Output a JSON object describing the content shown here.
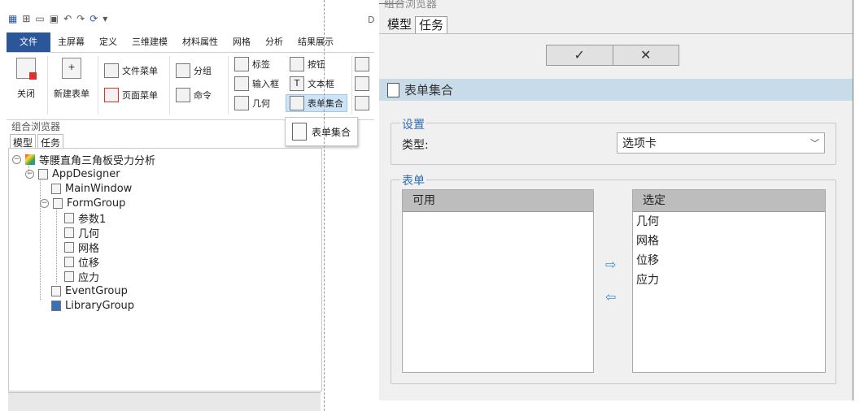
{
  "left": {
    "quick_access": [
      "▦",
      "⊞",
      "▭",
      "▣",
      "↶",
      "↷",
      "⟳",
      "▾"
    ],
    "menu": [
      "文件",
      "主屏幕",
      "定义",
      "三维建模",
      "材料属性",
      "网格",
      "分析",
      "结果展示"
    ],
    "ribbon": {
      "close": "关闭",
      "new_form": "新建表单",
      "file_menu": "文件菜单",
      "page_menu": "页面菜单",
      "group": "分组",
      "command": "命令",
      "label": "标签",
      "input_box": "输入框",
      "geometry": "几何",
      "button": "按钮",
      "text_box": "文本框",
      "form_collection": "表单集合"
    },
    "popup_label": "表单集合",
    "browser_title": "组合浏览器",
    "tabs": [
      "模型",
      "任务"
    ],
    "tree": {
      "root": "等腰直角三角板受力分析",
      "app": "AppDesigner",
      "main_window": "MainWindow",
      "form_group": "FormGroup",
      "forms": [
        "参数1",
        "几何",
        "网格",
        "位移",
        "应力"
      ],
      "event_group": "EventGroup",
      "library_group": "LibraryGroup"
    },
    "peek_text": "DE"
  },
  "right": {
    "title_partial": "组合浏览器",
    "tabs": [
      "模型",
      "任务"
    ],
    "ok_symbol": "✓",
    "cancel_symbol": "✕",
    "section_title": "表单集合",
    "settings": {
      "group_label": "设置",
      "type_label": "类型:",
      "type_value": "选项卡"
    },
    "forms": {
      "group_label": "表单",
      "available_header": "可用",
      "selected_header": "选定",
      "available_items": [],
      "selected_items": [
        "几何",
        "网格",
        "位移",
        "应力"
      ],
      "add_arrow": "⇨",
      "remove_arrow": "⇦"
    },
    "accent_color": "#2f6db5",
    "header_bg": "#c7dbe8"
  }
}
